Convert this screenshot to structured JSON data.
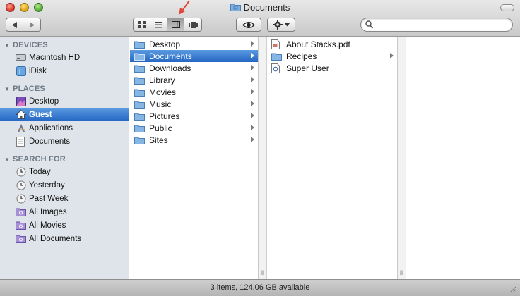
{
  "window": {
    "title": "Documents"
  },
  "toolbar": {
    "nav": [
      {
        "name": "back-icon"
      },
      {
        "name": "forward-icon"
      }
    ],
    "view_modes": [
      "icon-view-icon",
      "list-view-icon",
      "column-view-icon",
      "coverflow-view-icon"
    ],
    "active_view": "column-view-icon",
    "search": {
      "placeholder": "",
      "value": ""
    }
  },
  "sidebar": {
    "devices": {
      "label": "DEVICES",
      "items": [
        {
          "label": "Macintosh HD",
          "icon": "hard-drive-icon"
        },
        {
          "label": "iDisk",
          "icon": "idisk-icon"
        }
      ]
    },
    "places": {
      "label": "PLACES",
      "items": [
        {
          "label": "Desktop",
          "icon": "desktop-icon"
        },
        {
          "label": "Guest",
          "icon": "home-icon",
          "selected": true
        },
        {
          "label": "Applications",
          "icon": "applications-icon"
        },
        {
          "label": "Documents",
          "icon": "documents-icon"
        }
      ]
    },
    "search_for": {
      "label": "SEARCH FOR",
      "items": [
        {
          "label": "Today",
          "icon": "clock-icon"
        },
        {
          "label": "Yesterday",
          "icon": "clock-icon"
        },
        {
          "label": "Past Week",
          "icon": "clock-icon"
        },
        {
          "label": "All Images",
          "icon": "smart-folder-icon"
        },
        {
          "label": "All Movies",
          "icon": "smart-folder-icon"
        },
        {
          "label": "All Documents",
          "icon": "smart-folder-icon"
        }
      ]
    }
  },
  "column1": {
    "items": [
      {
        "label": "Desktop"
      },
      {
        "label": "Documents",
        "selected": true
      },
      {
        "label": "Downloads"
      },
      {
        "label": "Library"
      },
      {
        "label": "Movies"
      },
      {
        "label": "Music"
      },
      {
        "label": "Pictures"
      },
      {
        "label": "Public"
      },
      {
        "label": "Sites"
      }
    ]
  },
  "column2": {
    "items": [
      {
        "label": "About Stacks.pdf",
        "type": "pdf"
      },
      {
        "label": "Recipes",
        "type": "folder"
      },
      {
        "label": "Super User",
        "type": "webloc"
      }
    ]
  },
  "status": {
    "text": "3 items, 124.06 GB available"
  },
  "colors": {
    "selection": "#2f72cf",
    "sidebar_bg": "#dee4ea",
    "callout": "#e2483a"
  }
}
